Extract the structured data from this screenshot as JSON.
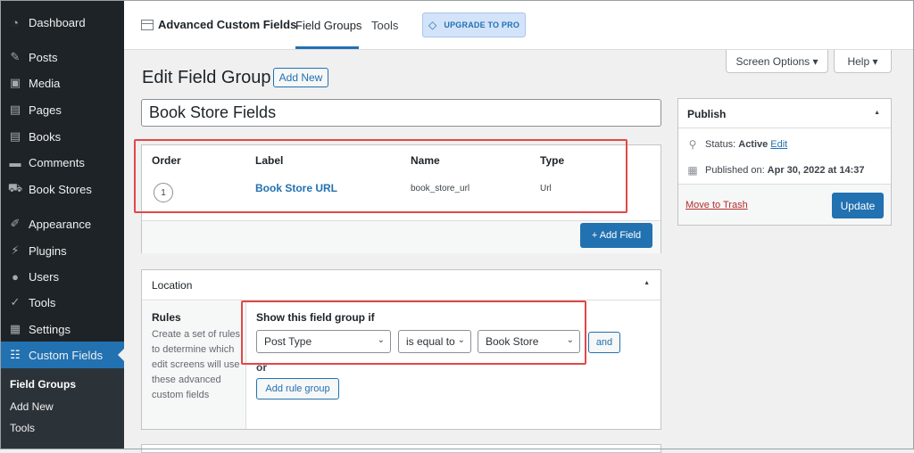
{
  "sidebar": {
    "items": [
      {
        "label": "Dashboard",
        "icon": "dashboard-icon"
      },
      {
        "label": "Posts",
        "icon": "pin-icon"
      },
      {
        "label": "Media",
        "icon": "media-icon"
      },
      {
        "label": "Pages",
        "icon": "pages-icon"
      },
      {
        "label": "Books",
        "icon": "book-icon"
      },
      {
        "label": "Comments",
        "icon": "comment-icon"
      },
      {
        "label": "Book Stores",
        "icon": "cart-icon"
      },
      {
        "label": "Appearance",
        "icon": "brush-icon"
      },
      {
        "label": "Plugins",
        "icon": "plugin-icon"
      },
      {
        "label": "Users",
        "icon": "user-icon"
      },
      {
        "label": "Tools",
        "icon": "wrench-icon"
      },
      {
        "label": "Settings",
        "icon": "settings-icon"
      },
      {
        "label": "Custom Fields",
        "icon": "custom-fields-icon"
      }
    ],
    "submenu": [
      "Field Groups",
      "Add New",
      "Tools"
    ]
  },
  "topbar": {
    "brand": "Advanced Custom Fields",
    "tabs": [
      "Field Groups",
      "Tools"
    ],
    "upgrade": "UPGRADE TO PRO"
  },
  "screen_options": {
    "screen": "Screen Options ▾",
    "help": "Help ▾"
  },
  "page": {
    "title": "Edit Field Group",
    "add_new": "Add New",
    "group_title": "Book Store Fields"
  },
  "fields": {
    "headers": {
      "order": "Order",
      "label": "Label",
      "name": "Name",
      "type": "Type"
    },
    "rows": [
      {
        "order": "1",
        "label": "Book Store URL",
        "name": "book_store_url",
        "type": "Url"
      }
    ],
    "add_field": "+ Add Field"
  },
  "location": {
    "title": "Location",
    "rules_title": "Rules",
    "rules_desc": "Create a set of rules to determine which edit screens will use these advanced custom fields",
    "show_if": "Show this field group if",
    "param": "Post Type",
    "operator": "is equal to",
    "value": "Book Store",
    "and": "and",
    "or": "or",
    "add_rule_group": "Add rule group"
  },
  "publish": {
    "title": "Publish",
    "status_label": "Status:",
    "status_value": "Active",
    "edit": "Edit",
    "published_label": "Published on:",
    "published_value": "Apr 30, 2022 at 14:37",
    "trash": "Move to Trash",
    "update": "Update"
  },
  "colors": {
    "accent": "#2271b1",
    "sidebar": "#1d2327",
    "highlight": "#e04848"
  }
}
